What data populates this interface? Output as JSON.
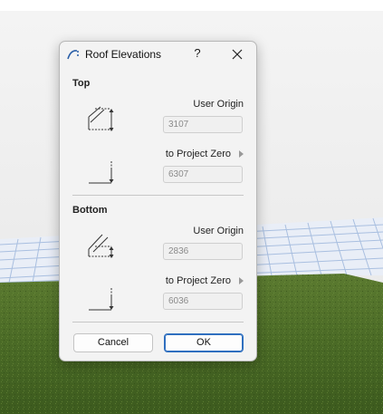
{
  "dialog": {
    "title": "Roof Elevations",
    "help_label": "?",
    "top": {
      "label": "Top",
      "user_origin_label": "User Origin",
      "user_origin_value": "3107",
      "project_zero_label": "to Project Zero",
      "project_zero_value": "6307"
    },
    "bottom": {
      "label": "Bottom",
      "user_origin_label": "User Origin",
      "user_origin_value": "2836",
      "project_zero_label": "to Project Zero",
      "project_zero_value": "6036"
    },
    "cancel_label": "Cancel",
    "ok_label": "OK"
  },
  "colors": {
    "sky": "#ececec",
    "grass": "#4a6a26",
    "grid_line": "#9fb6d9",
    "primary_border": "#2f6fbf"
  },
  "icons": {
    "title": "roof-arch-icon",
    "help": "help-icon",
    "close": "close-icon"
  }
}
